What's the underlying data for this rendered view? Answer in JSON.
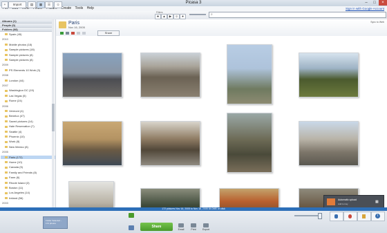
{
  "window": {
    "title": "Picasa 3"
  },
  "menu": [
    "File",
    "Edit",
    "View",
    "Folder",
    "Picture",
    "Create",
    "Tools",
    "Help"
  ],
  "signin": "Sign in with Google Account",
  "toolbar": {
    "import": "Import",
    "filters_label": "Filters"
  },
  "left": {
    "sections": [
      {
        "label": "Albums (1)"
      },
      {
        "label": "People (0)"
      },
      {
        "label": "Folders (68)"
      }
    ],
    "items": [
      {
        "type": "item",
        "label": "Spain (45)"
      },
      {
        "type": "year",
        "label": "2010"
      },
      {
        "type": "item",
        "label": "Mobile photos (18)"
      },
      {
        "type": "item",
        "label": "Sample pictures (18)"
      },
      {
        "type": "item",
        "label": "Sample pictures (8)"
      },
      {
        "type": "item",
        "label": "Sample pictures (8)"
      },
      {
        "type": "year",
        "label": "2009"
      },
      {
        "type": "item",
        "label": "PS Elements 10 Work (3)"
      },
      {
        "type": "year",
        "label": "2008"
      },
      {
        "type": "item",
        "label": "London (44)"
      },
      {
        "type": "year",
        "label": "2007"
      },
      {
        "type": "item",
        "label": "Washington DC (19)"
      },
      {
        "type": "item",
        "label": "Las Vegas (5)"
      },
      {
        "type": "item",
        "label": "Rome (24)"
      },
      {
        "type": "year",
        "label": "2006"
      },
      {
        "type": "item",
        "label": "Vermont (4)"
      },
      {
        "type": "item",
        "label": "Benelux (47)"
      },
      {
        "type": "item",
        "label": "Saved pictures (14)"
      },
      {
        "type": "item",
        "label": "Hale Reservation (7)"
      },
      {
        "type": "item",
        "label": "Seattle (4)"
      },
      {
        "type": "item",
        "label": "Phoenix (10)"
      },
      {
        "type": "item",
        "label": "Work (8)"
      },
      {
        "type": "item",
        "label": "New Mexico (8)"
      },
      {
        "type": "year",
        "label": "2005"
      },
      {
        "type": "item",
        "label": "Paris (172)",
        "selected": true
      },
      {
        "type": "item",
        "label": "Home (10)"
      },
      {
        "type": "item",
        "label": "Canada (5)"
      },
      {
        "type": "item",
        "label": "Family and Friends (8)"
      },
      {
        "type": "item",
        "label": "Farm (6)"
      },
      {
        "type": "item",
        "label": "Rhode Island (3)"
      },
      {
        "type": "item",
        "label": "Boston (11)"
      },
      {
        "type": "item",
        "label": "Los Angeles (14)"
      },
      {
        "type": "item",
        "label": "Ireland (56)"
      },
      {
        "type": "year",
        "label": "2003"
      }
    ]
  },
  "album": {
    "name": "Paris",
    "date": "Nov 16, 2005",
    "share_label": "Share",
    "sync_label": "Sync to Web"
  },
  "status": "172 pictures   Nov 16, 2005 to Nov 18, 2005   84.0MB on disk",
  "bottom": {
    "tray_label": "Folder Selected - 172 photos",
    "share_label": "Share",
    "actions": [
      "Email",
      "Print",
      "Export"
    ]
  },
  "notify": {
    "line1": "Automatic upload",
    "line2": "Add to tray"
  },
  "colors": {
    "accent": "#2d6fb8",
    "selection": "#bcd6f3",
    "share_green": "#4a9a2b"
  }
}
